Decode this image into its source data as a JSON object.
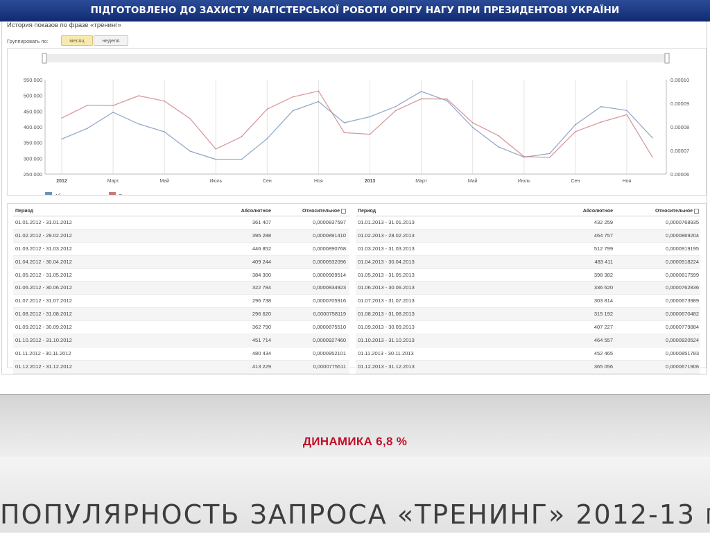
{
  "banner": "ПІДГОТОВЛЕНО ДО ЗАХИСТУ МАГІСТЕРСЬКОЇ РОБОТИ ОРІГУ НАГУ ПРИ ПРЕЗИДЕНТОВІ УКРАЇНИ",
  "history_title": "История показов по фразе «тренинг»",
  "group": {
    "label": "Группировать по:",
    "month": "месяц",
    "week": "неделя"
  },
  "colors": {
    "absolute": "#6f8fb7",
    "relative": "#c9777b",
    "grid": "#e3e3e3",
    "accent": "#c0102a"
  },
  "chart_data": {
    "type": "line",
    "x": [
      "01.2012",
      "02.2012",
      "03.2012",
      "04.2012",
      "05.2012",
      "06.2012",
      "07.2012",
      "08.2012",
      "09.2012",
      "10.2012",
      "11.2012",
      "12.2012",
      "01.2013",
      "02.2013",
      "03.2013",
      "04.2013",
      "05.2013",
      "06.2013",
      "07.2013",
      "08.2013",
      "09.2013",
      "10.2013",
      "11.2013",
      "12.2013"
    ],
    "x_tick_labels": [
      {
        "i": 0,
        "label": "2012",
        "bold": true
      },
      {
        "i": 2,
        "label": "Март"
      },
      {
        "i": 4,
        "label": "Май"
      },
      {
        "i": 6,
        "label": "Июль"
      },
      {
        "i": 8,
        "label": "Сен"
      },
      {
        "i": 10,
        "label": "Ноя"
      },
      {
        "i": 12,
        "label": "2013",
        "bold": true
      },
      {
        "i": 14,
        "label": "Март"
      },
      {
        "i": 16,
        "label": "Май"
      },
      {
        "i": 18,
        "label": "Июль"
      },
      {
        "i": 20,
        "label": "Сен"
      },
      {
        "i": 22,
        "label": "Ноя"
      }
    ],
    "series": [
      {
        "name": "Абсолютное",
        "axis": "left",
        "values": [
          361407,
          395288,
          446852,
          409244,
          384300,
          322784,
          296738,
          296620,
          362790,
          451714,
          480434,
          413229,
          432259,
          464757,
          512799,
          483411,
          398382,
          336620,
          303814,
          315192,
          407227,
          464557,
          452465,
          365056
        ]
      },
      {
        "name": "Относительное",
        "axis": "right",
        "values": [
          8.37597e-05,
          8.9141e-05,
          8.90768e-05,
          9.32096e-05,
          9.09514e-05,
          8.34923e-05,
          7.05916e-05,
          7.58119e-05,
          8.7551e-05,
          9.2746e-05,
          9.52101e-05,
          7.75511e-05,
          7.68935e-05,
          8.69204e-05,
          9.19195e-05,
          9.18224e-05,
          8.17599e-05,
          7.62836e-05,
          6.73989e-05,
          6.70482e-05,
          7.79884e-05,
          8.20524e-05,
          8.51783e-05,
          6.71906e-05
        ]
      }
    ],
    "y_left": {
      "ylim": [
        250000,
        550000
      ],
      "ticks": [
        "250.000",
        "300.000",
        "350.000",
        "400.000",
        "450.000",
        "500.000",
        "550.000"
      ]
    },
    "y_right": {
      "ylim": [
        6e-05,
        0.0001
      ],
      "ticks": [
        "0.00006",
        "0.00007",
        "0.00008",
        "0.00009",
        "0.00010"
      ]
    },
    "grid": true,
    "legend": "bottom-left"
  },
  "table": {
    "headers": {
      "period": "Период",
      "absolute": "Абсолютное",
      "relative": "Относительное"
    },
    "left": [
      {
        "period": "01.01.2012 - 31.01.2012",
        "abs": "361 407",
        "rel": "0,0000837597"
      },
      {
        "period": "01.02.2012 - 29.02.2012",
        "abs": "395 288",
        "rel": "0,0000891410"
      },
      {
        "period": "01.03.2012 - 31.03.2012",
        "abs": "446 852",
        "rel": "0,0000890768"
      },
      {
        "period": "01.04.2012 - 30.04.2012",
        "abs": "409 244",
        "rel": "0,0000932096"
      },
      {
        "period": "01.05.2012 - 31.05.2012",
        "abs": "384 300",
        "rel": "0,0000909514"
      },
      {
        "period": "01.06.2012 - 30.06.2012",
        "abs": "322 784",
        "rel": "0,0000834923"
      },
      {
        "period": "01.07.2012 - 31.07.2012",
        "abs": "296 738",
        "rel": "0,0000705916"
      },
      {
        "period": "01.08.2012 - 31.08.2012",
        "abs": "296 620",
        "rel": "0,0000758119"
      },
      {
        "period": "01.09.2012 - 30.09.2012",
        "abs": "362 790",
        "rel": "0,0000875510"
      },
      {
        "period": "01.10.2012 - 31.10.2012",
        "abs": "451 714",
        "rel": "0,0000927460"
      },
      {
        "period": "01.11.2012 - 30.11.2012",
        "abs": "480 434",
        "rel": "0,0000952101"
      },
      {
        "period": "01.12.2012 - 31.12.2012",
        "abs": "413 229",
        "rel": "0,0000775511"
      }
    ],
    "right": [
      {
        "period": "01.01.2013 - 31.01.2013",
        "abs": "432 259",
        "rel": "0,0000768935"
      },
      {
        "period": "01.02.2013 - 28.02.2013",
        "abs": "464 757",
        "rel": "0,0000869204"
      },
      {
        "period": "01.03.2013 - 31.03.2013",
        "abs": "512 799",
        "rel": "0,0000919195"
      },
      {
        "period": "01.04.2013 - 30.04.2013",
        "abs": "483 411",
        "rel": "0,0000918224"
      },
      {
        "period": "01.05.2013 - 31.05.2013",
        "abs": "398 382",
        "rel": "0,0000817599"
      },
      {
        "period": "01.06.2013 - 30.06.2013",
        "abs": "336 620",
        "rel": "0,0000762836"
      },
      {
        "period": "01.07.2013 - 31.07.2013",
        "abs": "303 814",
        "rel": "0,0000673989"
      },
      {
        "period": "01.08.2013 - 31.08.2013",
        "abs": "315 192",
        "rel": "0,0000670482"
      },
      {
        "period": "01.09.2013 - 30.09.2013",
        "abs": "407 227",
        "rel": "0,0000779884"
      },
      {
        "period": "01.10.2013 - 31.10.2013",
        "abs": "464 557",
        "rel": "0,0000820524"
      },
      {
        "period": "01.11.2013 - 30.11.2013",
        "abs": "452 465",
        "rel": "0,0000851783"
      },
      {
        "period": "01.12.2013 - 31.12.2013",
        "abs": "365 056",
        "rel": "0,0000671906"
      }
    ]
  },
  "dynamics": "ДИНАМИКА 6,8 %",
  "title": {
    "main": "ПОПУЛЯРНОСТЬ ЗАПРОСА «ТРЕНИНГ» 2012-13",
    "suffix": "ГГ"
  }
}
